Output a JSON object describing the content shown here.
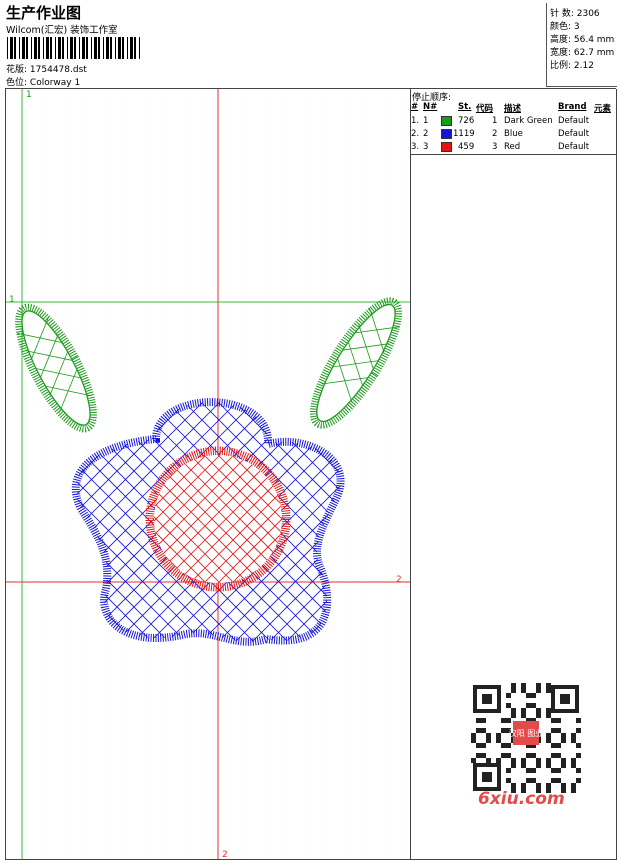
{
  "header": {
    "title": "生产作业图",
    "company": "Wilcom(汇宏) 装饰工作室",
    "design_label": "花版:",
    "design_file": "1754478.dst",
    "colorway_label": "色位:",
    "colorway": "Colorway 1"
  },
  "stats": {
    "stitches": "针 数: 2306",
    "colors": "颜色: 3",
    "height": "高度: 56.4 mm",
    "width": "宽度: 62.7 mm",
    "ratio": "比例: 2.12"
  },
  "canvas": {
    "marker_top_left": "1",
    "marker_left_mid": "1",
    "marker_right": "2",
    "marker_bottom": "2"
  },
  "stop_sequence": {
    "title": "停止顺序:",
    "columns": [
      "#",
      "N#",
      "St.",
      "代码",
      "描述",
      "Brand",
      "元素"
    ],
    "rows": [
      {
        "num": "1.",
        "needle": "1",
        "color": "#1a9a1a",
        "stitches": "726",
        "code": "1",
        "desc": "Dark Green",
        "brand": "Default"
      },
      {
        "num": "2.",
        "needle": "2",
        "color": "#1414d8",
        "stitches": "1119",
        "code": "2",
        "desc": "Blue",
        "brand": "Default"
      },
      {
        "num": "3.",
        "needle": "3",
        "color": "#e21414",
        "stitches": "459",
        "code": "3",
        "desc": "Red",
        "brand": "Default"
      }
    ]
  },
  "watermark": {
    "site": "6xiu.com",
    "qr_label": "汉阳 图业"
  }
}
